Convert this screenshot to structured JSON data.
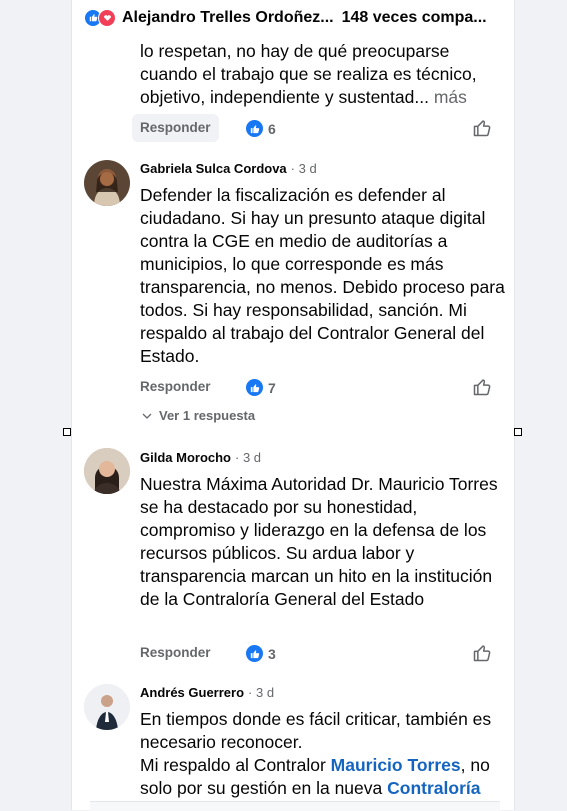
{
  "post": {
    "reaction_icons": [
      "like-icon",
      "love-icon"
    ],
    "reactors_text": "Alejandro Trelles Ordoñez...",
    "shares_text": "148 veces compa..."
  },
  "comments": [
    {
      "text": "lo respetan, no hay de qué preocuparse cuando el trabajo que se realiza es técnico, objetivo, independiente y sustentad...",
      "more": "más",
      "reply_label": "Responder",
      "reaction_count": "6"
    },
    {
      "author": "Gabriela Sulca Cordova",
      "time": "· 3 d",
      "text": "Defender la fiscalización es defender al ciudadano. Si hay un presunto ataque digital contra la CGE en medio de auditorías a municipios, lo que corresponde es más transparencia, no menos. Debido proceso para todos. Si hay responsabilidad, sanción. Mi respaldo al trabajo del Contralor General del Estado.",
      "reply_label": "Responder",
      "reaction_count": "7",
      "view_replies": "Ver 1 respuesta"
    },
    {
      "author": "Gilda Morocho",
      "time": "· 3 d",
      "text": "Nuestra Máxima Autoridad Dr. Mauricio Torres se ha destacado por su honestidad, compromiso y liderazgo en la defensa de los recursos públicos. Su ardua labor y transparencia marcan un hito en la institución de la Contraloría General del Estado",
      "reply_label": "Responder",
      "reaction_count": "3"
    },
    {
      "author": "Andrés Guerrero",
      "time": "· 3 d",
      "text_line1": "En tiempos donde es fácil criticar, también es necesario reconocer.",
      "text_line2_a": "Mi respaldo al Contralor ",
      "text_line2_link": "Mauricio Torres",
      "text_line2_b": ", no solo por su gestión en la nueva ",
      "text_line2_link2": "Contraloría"
    }
  ],
  "colors": {
    "like_blue": "#1877f2",
    "love_red": "#f33e58",
    "link_blue": "#1565c0",
    "secondary_text": "#65676b"
  }
}
